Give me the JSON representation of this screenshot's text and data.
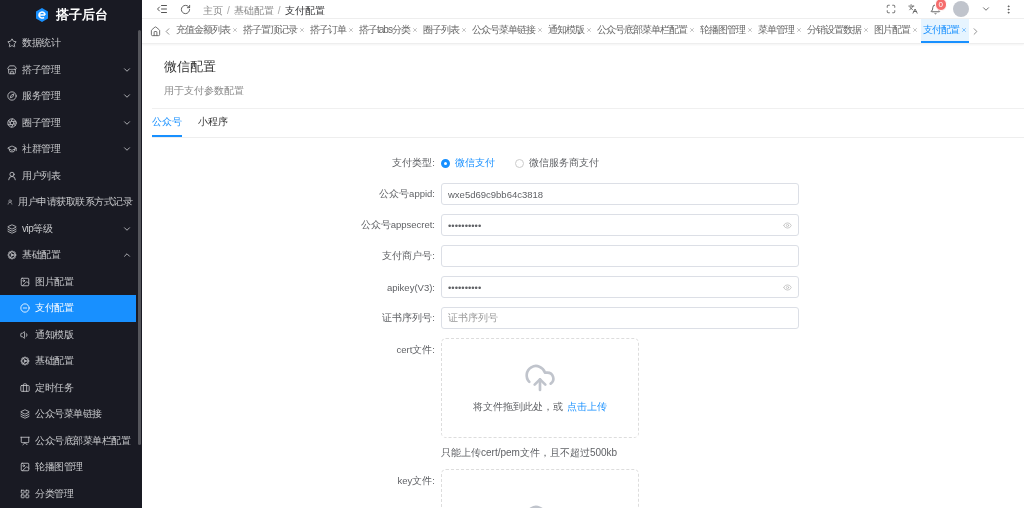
{
  "brand": {
    "title": "搭子后台"
  },
  "sidebar": {
    "items": [
      {
        "kind": "link",
        "label": "数据统计",
        "selected": false
      },
      {
        "kind": "group",
        "label": "搭子管理",
        "expanded": false,
        "selected": false
      },
      {
        "kind": "group",
        "label": "服务管理",
        "expanded": false,
        "selected": false
      },
      {
        "kind": "group",
        "label": "圈子管理",
        "expanded": false,
        "selected": false
      },
      {
        "kind": "group",
        "label": "社群管理",
        "expanded": false,
        "selected": false
      },
      {
        "kind": "link",
        "label": "用户列表",
        "selected": false
      },
      {
        "kind": "link",
        "label": "用户申请获取联系方式记录",
        "selected": false
      },
      {
        "kind": "group",
        "label": "vip等级",
        "expanded": false,
        "selected": false
      },
      {
        "kind": "group",
        "label": "基础配置",
        "expanded": true,
        "selected": false,
        "children": [
          {
            "label": "图片配置",
            "selected": false
          },
          {
            "label": "支付配置",
            "selected": true
          },
          {
            "label": "通知模版",
            "selected": false
          },
          {
            "label": "基础配置",
            "selected": false
          },
          {
            "label": "定时任务",
            "selected": false
          },
          {
            "label": "公众号菜单链接",
            "selected": false
          },
          {
            "label": "公众号底部菜单栏配置",
            "selected": false
          },
          {
            "label": "轮播图管理",
            "selected": false
          },
          {
            "label": "分类管理",
            "selected": false
          }
        ]
      }
    ]
  },
  "header": {
    "breadcrumb": [
      "主页",
      "基础配置",
      "支付配置"
    ],
    "breadcrumb_separator": "/",
    "notifications": "0"
  },
  "tabs": [
    {
      "label": "充值金额列表",
      "selected": false
    },
    {
      "label": "搭子置顶记录",
      "selected": false
    },
    {
      "label": "搭子订单",
      "selected": false
    },
    {
      "label": "搭子tabs分类",
      "selected": false
    },
    {
      "label": "圈子列表",
      "selected": false
    },
    {
      "label": "公众号菜单链接",
      "selected": false
    },
    {
      "label": "通知模版",
      "selected": false
    },
    {
      "label": "公众号底部菜单栏配置",
      "selected": false
    },
    {
      "label": "轮播图管理",
      "selected": false
    },
    {
      "label": "菜单管理",
      "selected": false
    },
    {
      "label": "分销设置数据",
      "selected": false
    },
    {
      "label": "图片配置",
      "selected": false
    },
    {
      "label": "支付配置",
      "selected": true
    }
  ],
  "page": {
    "title": "微信配置",
    "subtitle": "用于支付参数配置"
  },
  "subtabs": [
    {
      "label": "公众号",
      "selected": true
    },
    {
      "label": "小程序",
      "selected": false
    }
  ],
  "form": [
    {
      "kind": "radio",
      "label": "支付类型:",
      "options": [
        {
          "label": "微信支付",
          "selected": true
        },
        {
          "label": "微信服务商支付",
          "selected": false
        }
      ]
    },
    {
      "kind": "text",
      "label": "公众号appid:",
      "value": "wxe5d69c9bb64c3818"
    },
    {
      "kind": "password",
      "label": "公众号appsecret:",
      "value": "••••••••••"
    },
    {
      "kind": "text",
      "label": "支付商户号:"
    },
    {
      "kind": "password",
      "label": "apikey(V3):",
      "value": "••••••••••"
    },
    {
      "kind": "text",
      "label": "证书序列号:",
      "placeholder": "证书序列号"
    },
    {
      "kind": "upload",
      "label": "cert文件:",
      "drop_text": "将文件拖到此处，或",
      "link": "点击上传",
      "hint": "只能上传cert/pem文件，且不超过500kb"
    },
    {
      "kind": "upload",
      "label": "key文件:"
    }
  ]
}
